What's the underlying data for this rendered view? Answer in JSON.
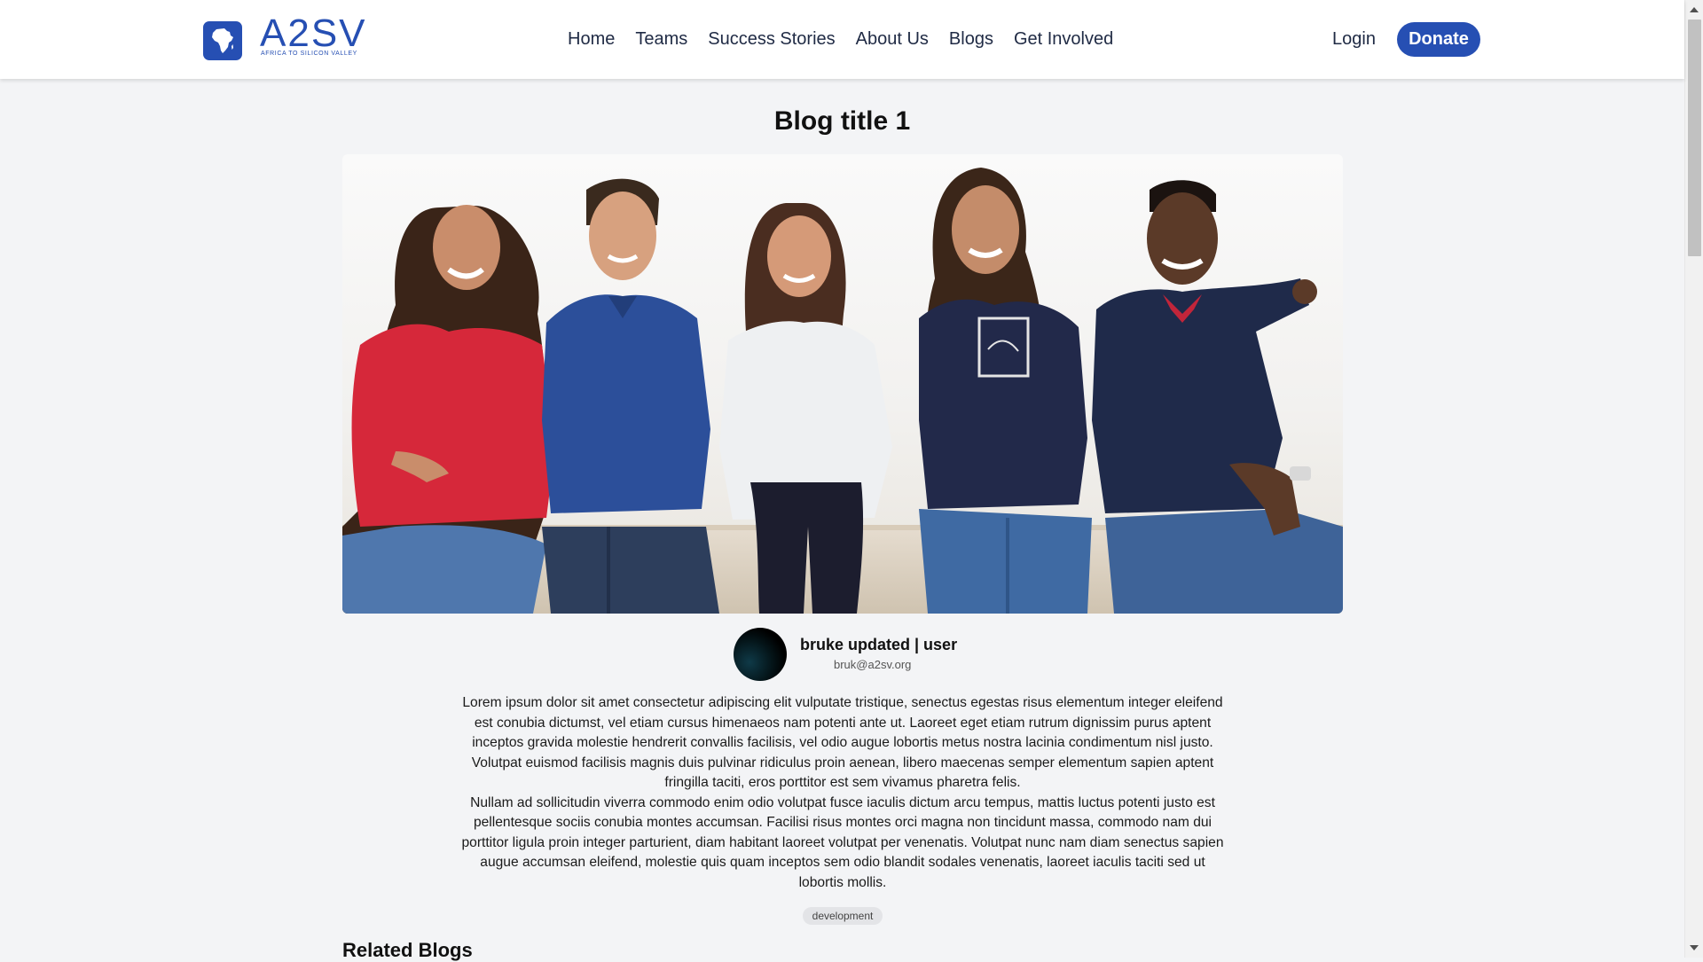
{
  "header": {
    "logo": {
      "wordmark": "A2SV",
      "tagline": "AFRICA TO SILICON VALLEY"
    },
    "nav": [
      {
        "label": "Home"
      },
      {
        "label": "Teams"
      },
      {
        "label": "Success Stories"
      },
      {
        "label": "About Us"
      },
      {
        "label": "Blogs"
      },
      {
        "label": "Get Involved"
      }
    ],
    "login_label": "Login",
    "donate_label": "Donate"
  },
  "blog": {
    "title": "Blog title 1",
    "hero_image": "group-of-five-smiling-people-photo",
    "author": {
      "name": "bruke updated | user",
      "email": "bruk@a2sv.org"
    },
    "paragraphs": [
      "Lorem ipsum dolor sit amet consectetur adipiscing elit vulputate tristique, senectus egestas risus elementum integer eleifend est conubia dictumst, vel etiam cursus himenaeos nam potenti ante ut. Laoreet eget etiam rutrum dignissim purus aptent inceptos gravida molestie hendrerit convallis facilisis, vel odio augue lobortis metus nostra lacinia condimentum nisl justo. Volutpat euismod facilisis magnis duis pulvinar ridiculus proin aenean, libero maecenas semper elementum sapien aptent fringilla taciti, eros porttitor est sem vivamus pharetra felis.",
      "Nullam ad sollicitudin viverra commodo enim odio volutpat fusce iaculis dictum arcu tempus, mattis luctus potenti justo est pellentesque sociis conubia montes accumsan. Facilisi risus montes orci magna non tincidunt massa, commodo nam dui porttitor ligula proin integer parturient, diam habitant laoreet volutpat per venenatis. Volutpat nunc nam diam senectus sapien augue accumsan eleifend, molestie quis quam inceptos sem odio blandit sodales venenatis, laoreet iaculis taciti sed ut lobortis mollis."
    ],
    "tag": "development"
  },
  "related": {
    "heading": "Related Blogs"
  },
  "colors": {
    "brand": "#264fb3",
    "page_bg": "#f3f4f6",
    "tag_bg": "#e3e4e7"
  }
}
